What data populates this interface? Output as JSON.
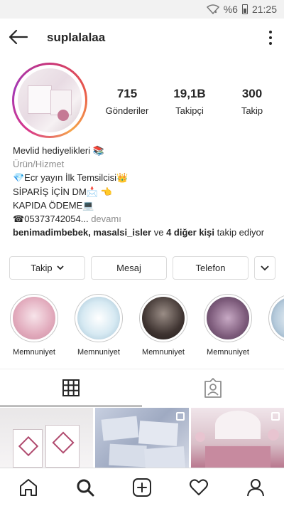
{
  "status_bar": {
    "battery_percent": "%6",
    "time": "21:25"
  },
  "header": {
    "username": "suplalalaa"
  },
  "stats": [
    {
      "value": "715",
      "label": "Gönderiler"
    },
    {
      "value": "19,1B",
      "label": "Takipçi"
    },
    {
      "value": "300",
      "label": "Takip"
    }
  ],
  "bio": {
    "name": "Mevlid hediyelikleri 📚",
    "category": "Ürün/Hizmet",
    "line1": "💎Ecr yayın İlk Temsilcisi👑",
    "line2": "SİPARİŞ İÇİN DM📩 👈",
    "line3": "KAPIDA ÖDEME💻",
    "line4": "☎05373742054...",
    "more": "devamı",
    "followed_names": "benimadimbebek, masalsi_isler",
    "followed_mid": " ve ",
    "followed_others": "4 diğer kişi",
    "followed_tail": " takip ediyor"
  },
  "buttons": {
    "follow": "Takip",
    "message": "Mesaj",
    "phone": "Telefon"
  },
  "highlights": [
    {
      "label": "Memnuniyet",
      "color": "#e8b9c8"
    },
    {
      "label": "Memnuniyet",
      "color": "#cfe3ee"
    },
    {
      "label": "Memnuniyet",
      "color": "#4a3f3c"
    },
    {
      "label": "Memnuniyet",
      "color": "#8d6f8c"
    },
    {
      "label": "Mem",
      "color": "#c9d8e4"
    }
  ],
  "tabs": [
    {
      "icon": "grid-icon"
    },
    {
      "icon": "tagged-icon"
    }
  ],
  "bottom_nav": [
    "home-icon",
    "search-icon",
    "add-icon",
    "heart-icon",
    "profile-icon"
  ]
}
